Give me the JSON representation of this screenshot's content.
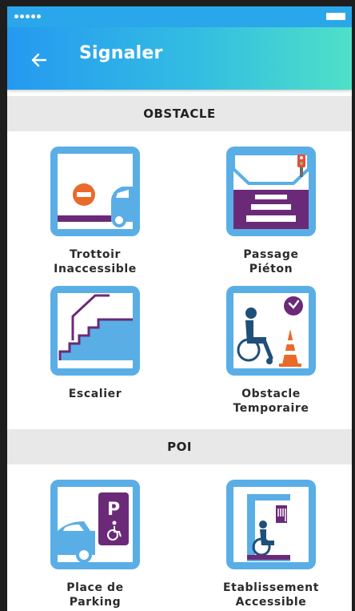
{
  "app": {
    "title": "Signaler"
  },
  "colors": {
    "accent_blue": "#2599f0",
    "accent_teal": "#4fe0c8",
    "icon_blue": "#5aaee6",
    "purple": "#6b2a78"
  },
  "sections": [
    {
      "header": "OBSTACLE",
      "items": [
        {
          "line1": "Trottoir",
          "line2": "Inaccessible",
          "icon": "blocked-sidewalk-icon"
        },
        {
          "line1": "Passage",
          "line2": "Piéton",
          "icon": "crosswalk-icon"
        },
        {
          "line1": "Escalier",
          "line2": "",
          "icon": "stairs-icon"
        },
        {
          "line1": "Obstacle",
          "line2": "Temporaire",
          "icon": "temporary-obstacle-icon"
        }
      ]
    },
    {
      "header": "POI",
      "items": [
        {
          "line1": "Place de",
          "line2": "Parking",
          "icon": "disabled-parking-icon"
        },
        {
          "line1": "Etablissement",
          "line2": "Accessible",
          "icon": "accessible-establishment-icon"
        }
      ]
    }
  ]
}
